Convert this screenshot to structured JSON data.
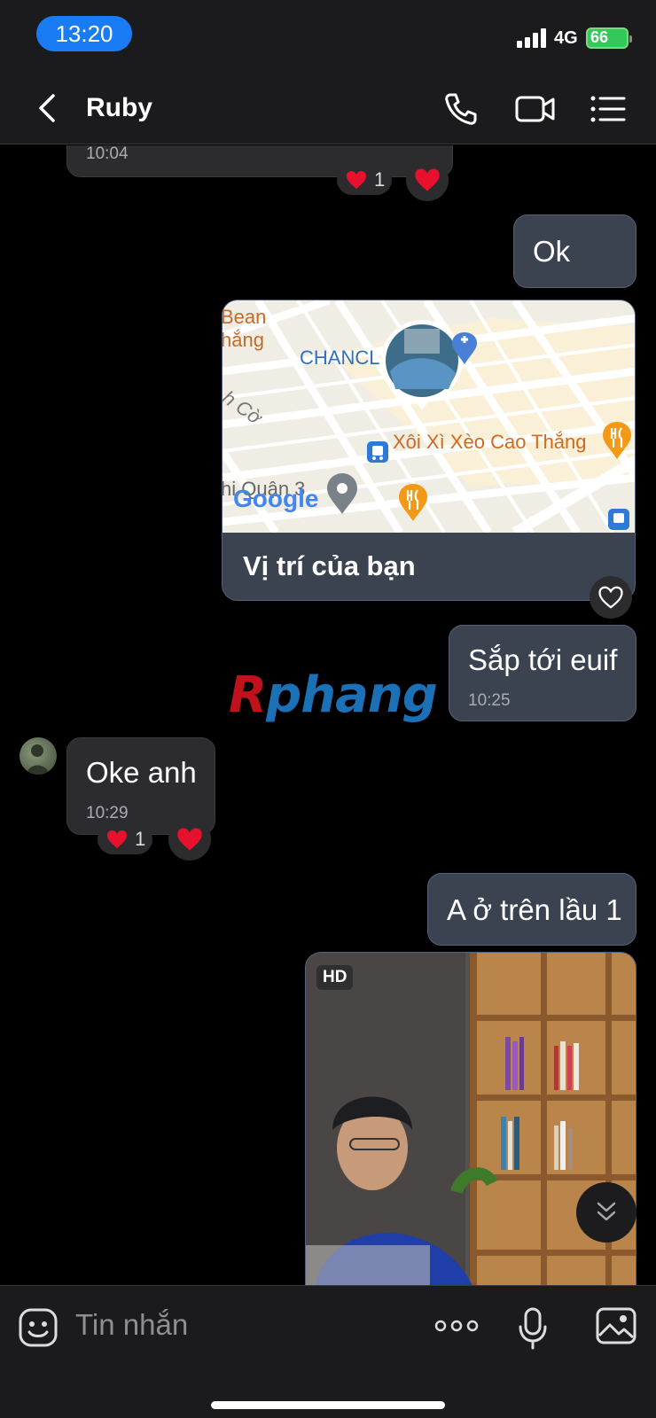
{
  "status_bar": {
    "time": "13:20",
    "network": "4G",
    "battery": "66"
  },
  "header": {
    "contact_name": "Ruby"
  },
  "messages": {
    "prev_time": "10:04",
    "prev_reaction_count": "1",
    "ok_text": "Ok",
    "location": {
      "caption": "Vị trí của bạn",
      "map_labels": {
        "bean": "Bean",
        "thang": "hắng",
        "chancl": "CHANCL",
        "co": "h Cờ",
        "xoi": "Xôi Xì Xèo Cao Thắng",
        "quan3": "hi Quận 3",
        "google": "Google"
      }
    },
    "sap_toi_text": "Sắp tới euif",
    "sap_toi_time": "10:25",
    "oke_text": "Oke anh",
    "oke_time": "10:29",
    "oke_reaction_count": "1",
    "lau_text": "A ở trên lầu 1",
    "photo_badge": "HD"
  },
  "watermark": {
    "part1": "R",
    "part2": "phang"
  },
  "composer": {
    "placeholder": "Tin nhắn"
  },
  "colors": {
    "accent": "#1a7cf5",
    "outgoing_bubble": "#3b4250",
    "incoming_bubble": "#2c2c2e",
    "heart": "#e8112d",
    "battery": "#34c759"
  }
}
